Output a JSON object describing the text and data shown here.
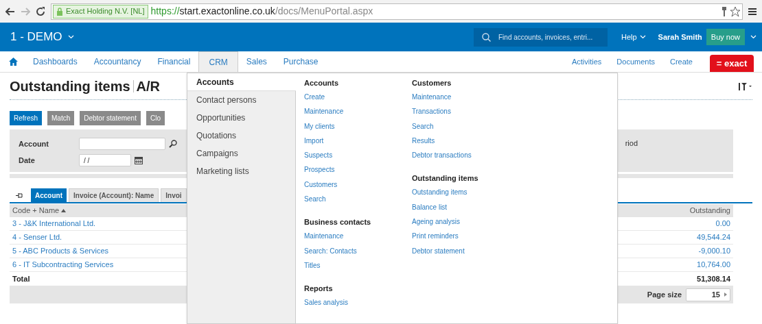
{
  "browser": {
    "site_identity": "Exact Holding N.V. [NL]",
    "url_scheme": "https://",
    "url_host": "start.exactonline.co.uk",
    "url_path": "/docs/MenuPortal.aspx"
  },
  "header": {
    "company": "1 - DEMO",
    "search": {
      "placeholder": "Find accounts, invoices, entri..."
    },
    "help": "Help",
    "user": "Sarah Smith",
    "buy": "Buy now"
  },
  "nav": {
    "items": [
      {
        "label": "Dashboards",
        "selected": false
      },
      {
        "label": "Accountancy",
        "selected": false
      },
      {
        "label": "Financial",
        "selected": false
      },
      {
        "label": "CRM",
        "selected": true
      },
      {
        "label": "Sales",
        "selected": false
      },
      {
        "label": "Purchase",
        "selected": false
      }
    ],
    "right_links": [
      "Activities",
      "Documents",
      "Create"
    ],
    "logo": "= exact"
  },
  "page": {
    "title": "Outstanding items",
    "subtitle": "A/R",
    "buttons": [
      {
        "label": "Refresh",
        "kind": "primary"
      },
      {
        "label": "Match",
        "kind": "secondary"
      },
      {
        "label": "Debtor statement",
        "kind": "secondary"
      },
      {
        "label": "Clo",
        "kind": "secondary"
      }
    ],
    "filters": [
      {
        "label": "Account",
        "kind": "search"
      },
      {
        "label": "Date",
        "kind": "date",
        "value": "/ /"
      }
    ],
    "filter_extra": "riod",
    "tabs": [
      {
        "label": "Account",
        "selected": true
      },
      {
        "label": "Invoice (Account): Name",
        "selected": false
      },
      {
        "label": "Invoi",
        "selected": false
      }
    ],
    "table": {
      "columns": [
        "Code + Name",
        "Outstanding"
      ],
      "rows": [
        {
          "name": "3 - J&K International Ltd.",
          "outstanding": "0.00"
        },
        {
          "name": "4 - Senser Ltd.",
          "outstanding": "49,544.24"
        },
        {
          "name": "5 - ABC Products & Services",
          "outstanding": "-9,000.10"
        },
        {
          "name": "6 - IT Subcontracting Services",
          "outstanding": "10,764.00"
        }
      ],
      "total": {
        "label": "Total",
        "value": "51,308.14"
      },
      "page_size": {
        "label": "Page size",
        "value": "15"
      }
    }
  },
  "menu": {
    "categories": [
      {
        "label": "Accounts",
        "selected": true
      },
      {
        "label": "Contact persons",
        "selected": false
      },
      {
        "label": "Opportunities",
        "selected": false
      },
      {
        "label": "Quotations",
        "selected": false
      },
      {
        "label": "Campaigns",
        "selected": false
      },
      {
        "label": "Marketing lists",
        "selected": false
      }
    ],
    "columns": [
      [
        {
          "title": "Accounts",
          "links": [
            "Create",
            "Maintenance",
            "My clients",
            "Import",
            "Suspects",
            "Prospects",
            "Customers",
            "Search"
          ]
        },
        {
          "title": "Business contacts",
          "links": [
            "Maintenance",
            "Search: Contacts",
            "Titles"
          ]
        },
        {
          "title": "Reports",
          "links": [
            "Sales analysis"
          ]
        }
      ],
      [
        {
          "title": "Customers",
          "links": [
            "Maintenance",
            "Transactions",
            "Search",
            "Results",
            "Debtor transactions"
          ]
        },
        {
          "title": "Outstanding items",
          "links": [
            "Outstanding items",
            "Balance list",
            "Ageing analysis",
            "Print reminders",
            "Debtor statement"
          ]
        }
      ]
    ]
  }
}
